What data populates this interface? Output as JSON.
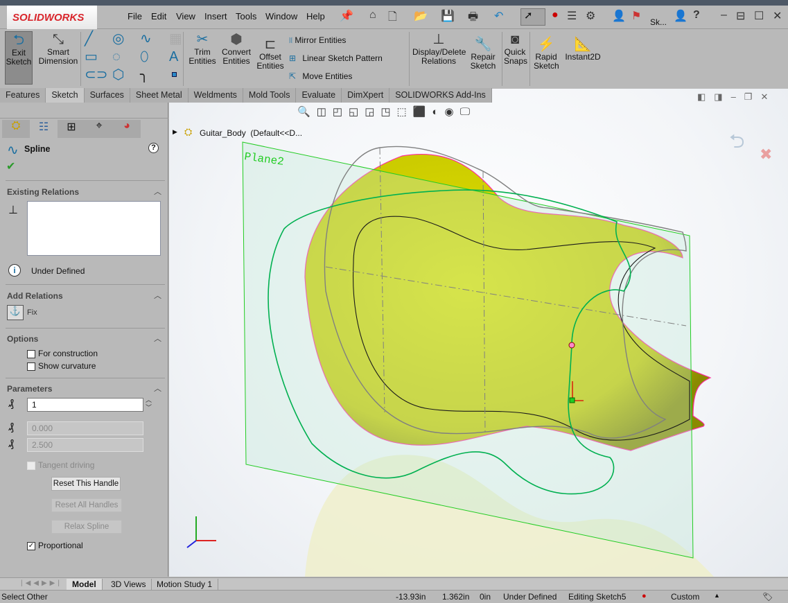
{
  "app": {
    "logo": "SOLIDWORKS",
    "brand_color": "#d9262c",
    "title_short": "Sk..."
  },
  "menu": [
    "File",
    "Edit",
    "View",
    "Insert",
    "Tools",
    "Window",
    "Help"
  ],
  "ribbon": {
    "exit_sketch": "Exit Sketch",
    "smart_dimension": "Smart Dimension",
    "trim_entities": "Trim Entities",
    "convert_entities": "Convert Entities",
    "offset_entities": "Offset Entities",
    "mirror_entities": "Mirror Entities",
    "linear_sketch_pattern": "Linear Sketch Pattern",
    "move_entities": "Move Entities",
    "display_delete_relations": "Display/Delete Relations",
    "repair_sketch": "Repair Sketch",
    "quick_snaps": "Quick Snaps",
    "rapid_sketch": "Rapid Sketch",
    "instant2d": "Instant2D"
  },
  "command_tabs": [
    "Features",
    "Sketch",
    "Surfaces",
    "Sheet Metal",
    "Weldments",
    "Mold Tools",
    "Evaluate",
    "DimXpert",
    "SOLIDWORKS Add-Ins"
  ],
  "active_command_tab": "Sketch",
  "property_manager": {
    "title": "Spline",
    "existing_relations": {
      "header": "Existing Relations",
      "status": "Under Defined"
    },
    "add_relations": {
      "header": "Add Relations",
      "fix": "Fix"
    },
    "options": {
      "header": "Options",
      "for_construction": "For construction",
      "show_curvature": "Show curvature"
    },
    "parameters": {
      "header": "Parameters",
      "point_number": "1",
      "tangent_weight": "0.000",
      "tangent_radial": "2.500",
      "tangent_driving": "Tangent driving",
      "reset_this_handle": "Reset This Handle",
      "reset_all_handles": "Reset All Handles",
      "relax_spline": "Relax Spline",
      "proportional": "Proportional",
      "proportional_checked": true
    }
  },
  "viewport": {
    "tree_item": "Guitar_Body  (Default<<D...",
    "plane_label": "Plane2",
    "body_color": "#d6d600",
    "plane_color": "#22cc22",
    "sketch_color": "#00b050"
  },
  "bottom_tabs": [
    "Model",
    "3D Views",
    "Motion Study 1"
  ],
  "active_bottom_tab": "Model",
  "status": {
    "left": "Select Other",
    "x": "-13.93in",
    "y": "1.362in",
    "z": "0in",
    "state": "Under Defined",
    "editing": "Editing Sketch5",
    "units": "Custom"
  }
}
